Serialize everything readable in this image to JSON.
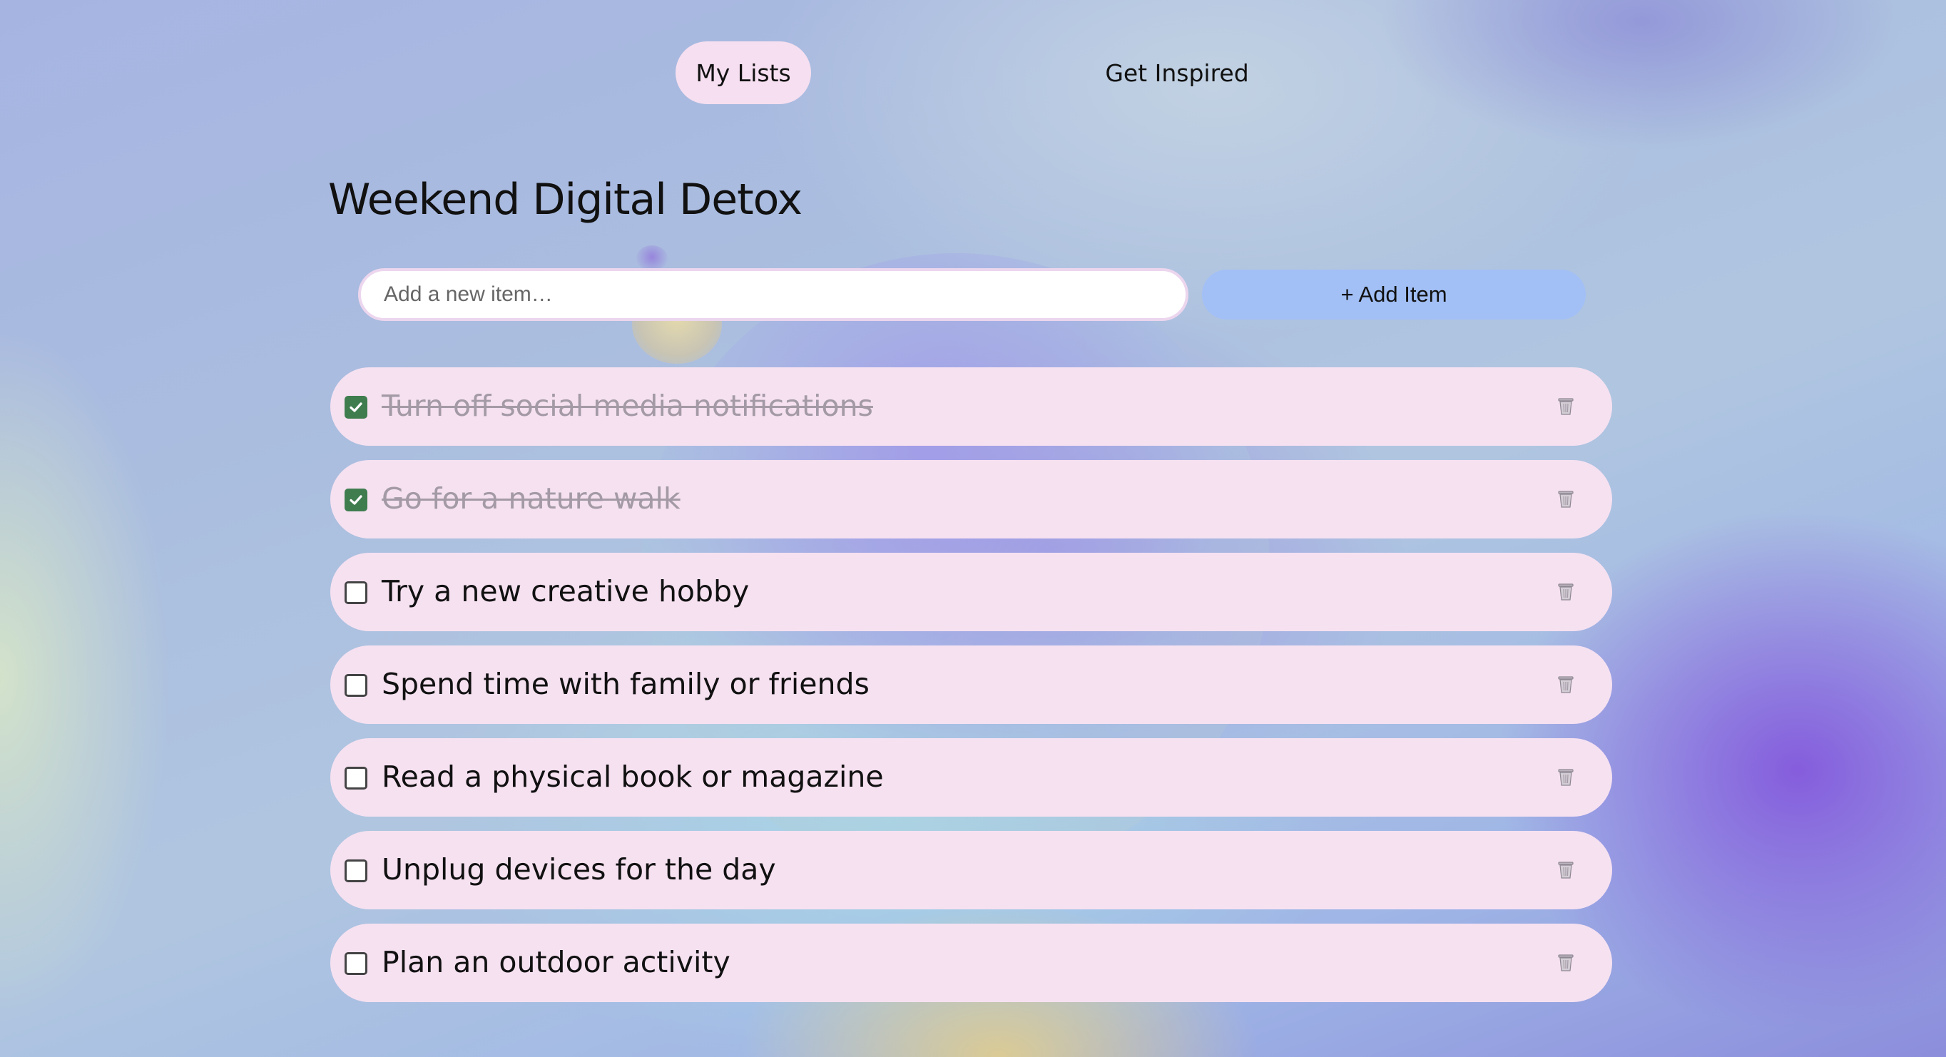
{
  "nav": {
    "tabs": [
      {
        "label": "My Lists",
        "active": true
      },
      {
        "label": "Get Inspired",
        "active": false
      }
    ]
  },
  "list": {
    "title": "Weekend Digital Detox"
  },
  "add": {
    "placeholder": "Add a new item…",
    "value": "",
    "button_label": "+ Add Item"
  },
  "items": [
    {
      "text": "Turn off social media notifications",
      "checked": true
    },
    {
      "text": "Go for a nature walk",
      "checked": true
    },
    {
      "text": "Try a new creative hobby",
      "checked": false
    },
    {
      "text": "Spend time with family or friends",
      "checked": false
    },
    {
      "text": "Read a physical book or magazine",
      "checked": false
    },
    {
      "text": "Unplug devices for the day",
      "checked": false
    },
    {
      "text": "Plan an outdoor activity",
      "checked": false
    }
  ],
  "icons": {
    "check": "checkmark-icon",
    "delete": "trash-icon"
  },
  "colors": {
    "item_bg": "#f6e1f1",
    "active_tab_bg": "#f6dff0",
    "button_bg": "#a2c0f6",
    "checked_color": "#3f7d4f",
    "done_text": "#a39aa6"
  }
}
